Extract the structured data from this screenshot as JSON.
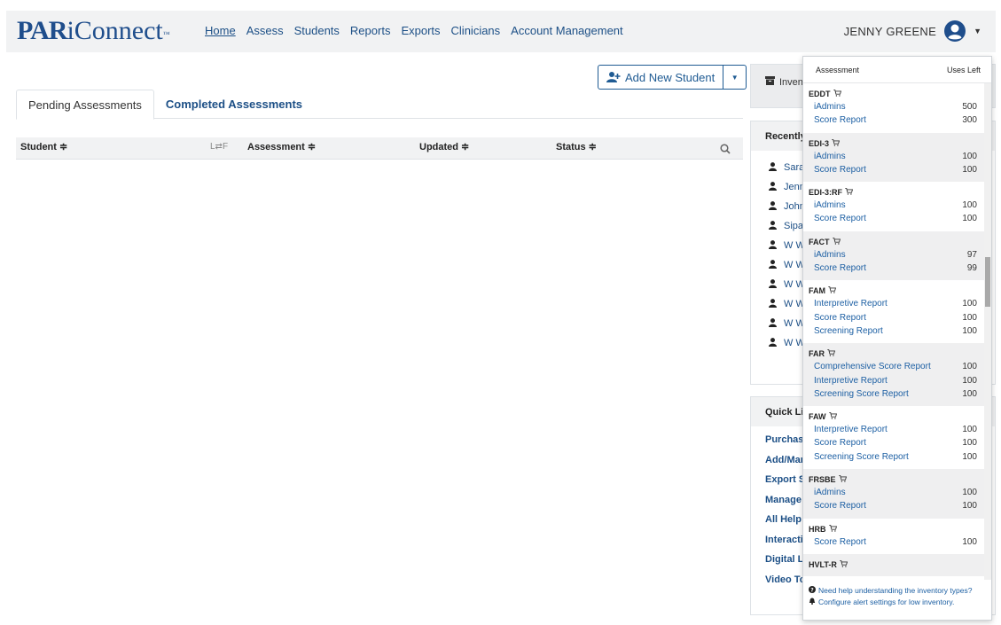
{
  "brand": {
    "par": "PAR",
    "rest": "iConnect",
    "tm": "™"
  },
  "nav": [
    "Home",
    "Assess",
    "Students",
    "Reports",
    "Exports",
    "Clinicians",
    "Account Management"
  ],
  "user": {
    "name": "JENNY GREENE"
  },
  "add_student_label": "Add New Student",
  "tabs": [
    "Pending Assessments",
    "Completed Assessments"
  ],
  "columns": {
    "student": "Student ≑",
    "lf": "L⇄F",
    "assessment": "Assessment ≑",
    "updated": "Updated ≑",
    "status": "Status ≑"
  },
  "right_panel": {
    "inventory_label": "Invent",
    "recent_title": "Recently",
    "recent_students": [
      "Sarah",
      "Jenni",
      "John",
      "Sipa",
      "W W",
      "W W",
      "W W",
      "W W",
      "W W",
      "W W"
    ],
    "quick_links_title": "Quick Lin",
    "quick_links": [
      "Purchase",
      "Add/Mar",
      "Export St",
      "Manage",
      "All Help",
      "Interacti",
      "Digital Li",
      "Video To"
    ]
  },
  "inventory": {
    "header_assessment": "Assessment",
    "header_uses": "Uses Left",
    "groups": [
      {
        "name": "EDDT",
        "items": [
          {
            "name": "iAdmins",
            "count": "500"
          },
          {
            "name": "Score Report",
            "count": "300"
          }
        ]
      },
      {
        "name": "EDI-3",
        "items": [
          {
            "name": "iAdmins",
            "count": "100"
          },
          {
            "name": "Score Report",
            "count": "100"
          }
        ]
      },
      {
        "name": "EDI-3:RF",
        "items": [
          {
            "name": "iAdmins",
            "count": "100"
          },
          {
            "name": "Score Report",
            "count": "100"
          }
        ]
      },
      {
        "name": "FACT",
        "items": [
          {
            "name": "iAdmins",
            "count": "97"
          },
          {
            "name": "Score Report",
            "count": "99"
          }
        ]
      },
      {
        "name": "FAM",
        "items": [
          {
            "name": "Interpretive Report",
            "count": "100"
          },
          {
            "name": "Score Report",
            "count": "100"
          },
          {
            "name": "Screening Report",
            "count": "100"
          }
        ]
      },
      {
        "name": "FAR",
        "items": [
          {
            "name": "Comprehensive Score Report",
            "count": "100"
          },
          {
            "name": "Interpretive Report",
            "count": "100"
          },
          {
            "name": "Screening Score Report",
            "count": "100"
          }
        ]
      },
      {
        "name": "FAW",
        "items": [
          {
            "name": "Interpretive Report",
            "count": "100"
          },
          {
            "name": "Score Report",
            "count": "100"
          },
          {
            "name": "Screening Score Report",
            "count": "100"
          }
        ]
      },
      {
        "name": "FRSBE",
        "items": [
          {
            "name": "iAdmins",
            "count": "100"
          },
          {
            "name": "Score Report",
            "count": "100"
          }
        ]
      },
      {
        "name": "HRB",
        "items": [
          {
            "name": "Score Report",
            "count": "100"
          }
        ]
      },
      {
        "name": "HVLT-R",
        "items": []
      }
    ],
    "footer_help": "Need help understanding the inventory types?",
    "footer_alert": "Configure alert settings for low inventory."
  }
}
